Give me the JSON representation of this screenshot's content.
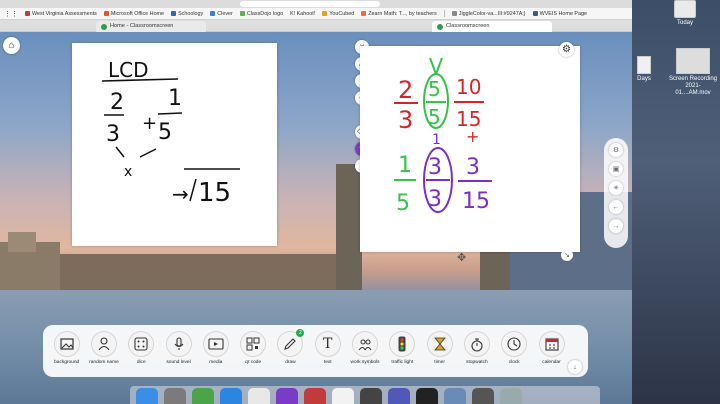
{
  "bookmarks": [
    {
      "label": "West Virginia Assessments",
      "color": "#c23b3b"
    },
    {
      "label": "Microsoft Office Home",
      "color": "#e0542a"
    },
    {
      "label": "Schoology",
      "color": "#2a68c7"
    },
    {
      "label": "Clever",
      "color": "#3a7be0"
    },
    {
      "label": "ClassDojo logo",
      "color": "#5bb14b"
    },
    {
      "label": "K! Kahoot!",
      "color": "#46178f"
    },
    {
      "label": "YouCubed",
      "color": "#e6a21a"
    },
    {
      "label": "Zearn Math: T..., by teachers",
      "color": "#f26b3a"
    },
    {
      "label": "JiggleColor-va...III:#9247A;}",
      "color": "#888888"
    },
    {
      "label": "WVEIS Home Page",
      "color": "#3d5a8c"
    }
  ],
  "tabs": [
    {
      "label": "Home - Classroomscreen",
      "active": false
    },
    {
      "label": "Classroomscreen",
      "active": true
    }
  ],
  "desktop": {
    "today_label": "Today",
    "days_label": "Days",
    "recording_label_1": "Screen Recording",
    "recording_label_2": "2021-01....AM.mov"
  },
  "board_left": {
    "heading": "LCD",
    "frac1_num": "2",
    "frac1_den": "3",
    "plus": "+",
    "frac2_num": "1",
    "frac2_den": "5",
    "times": "x",
    "arrow": "→",
    "result": "15"
  },
  "board_right": {
    "top_frac1_num": "2",
    "top_frac1_den": "3",
    "circle_num": "5",
    "circle_den": "5",
    "top_result_num": "10",
    "top_result_den": "15",
    "plus": "+",
    "bottom_frac1_num": "1",
    "bottom_frac1_den": "5",
    "circle2_num": "3",
    "circle2_den": "3",
    "bottom_result_num": "3",
    "bottom_result_den": "15"
  },
  "colors": {
    "red_ink": "#d8232a",
    "green_ink": "#35c24a",
    "purple_ink": "#7b2fc4",
    "black_ink": "#111111",
    "pen_active": "#7b3fc8"
  },
  "widgets": [
    {
      "label": "background",
      "icon": "image-icon"
    },
    {
      "label": "random name",
      "icon": "person-icon"
    },
    {
      "label": "dice",
      "icon": "dice-icon"
    },
    {
      "label": "sound level",
      "icon": "microphone-icon"
    },
    {
      "label": "media",
      "icon": "media-icon"
    },
    {
      "label": "qr code",
      "icon": "qr-code-icon"
    },
    {
      "label": "draw",
      "icon": "pencil-icon",
      "badge": "2"
    },
    {
      "label": "text",
      "icon": "text-icon"
    },
    {
      "label": "work symbols",
      "icon": "work-symbols-icon"
    },
    {
      "label": "traffic light",
      "icon": "traffic-light-icon"
    },
    {
      "label": "timer",
      "icon": "hourglass-icon"
    },
    {
      "label": "stopwatch",
      "icon": "stopwatch-icon"
    },
    {
      "label": "clock",
      "icon": "clock-icon"
    },
    {
      "label": "calendar",
      "icon": "calendar-icon"
    }
  ]
}
